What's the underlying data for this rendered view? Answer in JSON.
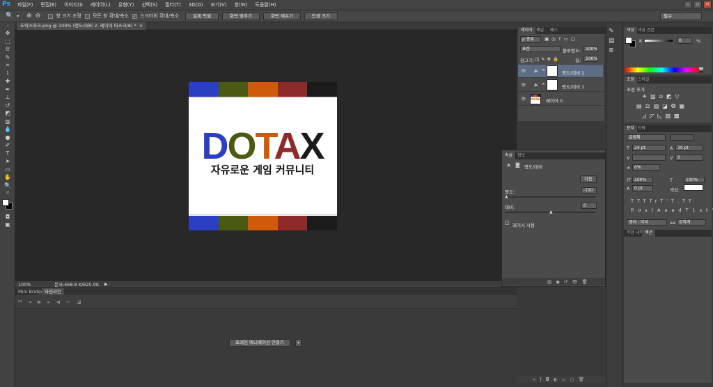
{
  "app": {
    "logo": "Ps"
  },
  "menu": [
    "파일(F)",
    "편집(E)",
    "이미지(I)",
    "레이어(L)",
    "유형(Y)",
    "선택(S)",
    "필터(T)",
    "3D(D)",
    "보기(V)",
    "창(W)",
    "도움말(H)"
  ],
  "window_controls": [
    "–",
    "▫",
    "✕"
  ],
  "options": {
    "opt1": "창 크기 조정",
    "opt2": "모든 창 확대/축소",
    "opt3": "스크러비 확대/축소",
    "btn_actual": "실제 픽셀",
    "btn_fit": "화면 맞추기",
    "btn_fill": "화면 채우기",
    "btn_print": "인쇄 크기",
    "workspace": "필수"
  },
  "document": {
    "tab_title": "도탁스마크.png @ 100% (명도/대비 2, 레이어 마스크/8) *",
    "tab_close": "×",
    "logo_text": "DOTAX",
    "subtitle": "자유로운 게임 커뮤니티",
    "stripe_colors": [
      "#2b3fc2",
      "#4a5a12",
      "#d05a0c",
      "#8e2a2a",
      "#1b1b1b"
    ]
  },
  "status": {
    "zoom": "100%",
    "doc_size": "문서:468.8 K/625.0K"
  },
  "timeline": {
    "tabs": [
      "Mini Bridge",
      "타임라인"
    ],
    "create_button": "프레임 애니메이션 만들기"
  },
  "layers": {
    "tabs": [
      "레이어",
      "채널",
      "패스"
    ],
    "kind": "종류",
    "blend_mode": "표준",
    "opacity_label": "불투명도:",
    "opacity": "100%",
    "lock_label": "잠그기:",
    "fill_label": "칠:",
    "fill": "100%",
    "items": [
      {
        "name": "명도/대비 2",
        "type": "adjust",
        "selected": true
      },
      {
        "name": "명도/대비 1",
        "type": "adjust",
        "selected": false
      },
      {
        "name": "레이어 0",
        "type": "image",
        "selected": false
      }
    ]
  },
  "properties": {
    "tabs": [
      "속성",
      "정보"
    ],
    "title": "명도/대비",
    "auto": "자동",
    "brightness_label": "명도:",
    "brightness": "-150",
    "contrast_label": "대비:",
    "contrast": "0",
    "legacy_label": "레거시 사용"
  },
  "color_panel": {
    "tabs": [
      "색상",
      "색상 견본"
    ],
    "k_label": "K",
    "k_value": "0",
    "k_unit": "%"
  },
  "adjustments": {
    "tabs": [
      "조정",
      "스타일"
    ],
    "add_label": "조정 추가"
  },
  "character": {
    "tabs": [
      "문자",
      "단락"
    ],
    "font": "굴림체",
    "size": "24 pt",
    "leading": "30 pt",
    "kerning": "0",
    "tracking": "0%",
    "vscale": "100%",
    "hscale": "100%",
    "baseline": "0 pt",
    "color_label": "색상:",
    "language": "영어 : 미국",
    "aa": "강하게",
    "aa_prefix": "aa"
  },
  "history": {
    "tabs": [
      "작업 내역",
      "액션"
    ]
  },
  "colors": {
    "accent": "#31a8ff",
    "selected_layer": "#5d6d86"
  }
}
